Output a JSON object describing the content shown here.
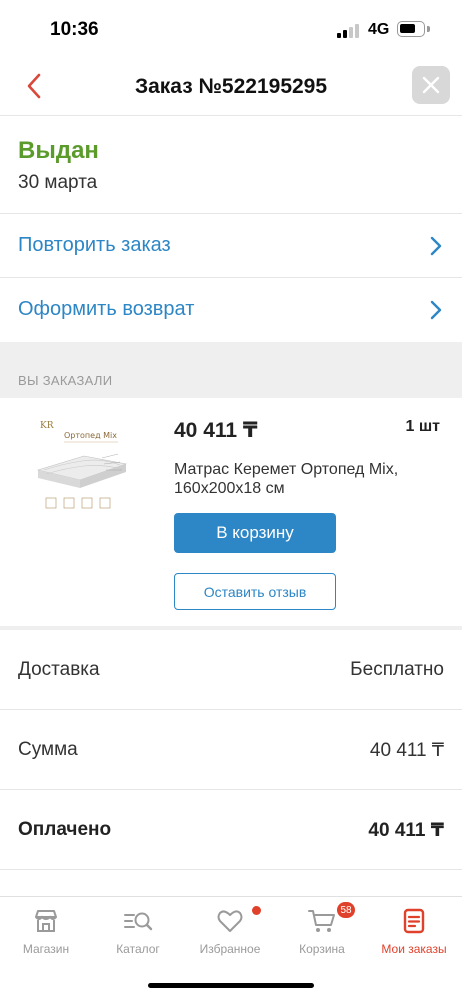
{
  "status_bar": {
    "time": "10:36",
    "network": "4G"
  },
  "header": {
    "title": "Заказ №522195295"
  },
  "order": {
    "status": "Выдан",
    "date": "30 марта"
  },
  "actions": {
    "repeat": "Повторить заказ",
    "return": "Оформить возврат"
  },
  "section": {
    "ordered_label": "ВЫ ЗАКАЗАЛИ"
  },
  "product": {
    "price": "40 411 ₸",
    "quantity": "1 шт",
    "name": "Матрас Керемет Ортопед Mix, 160x200x18 см",
    "image_caption": "Ортопед Mix",
    "cart_button": "В корзину",
    "review_button": "Оставить отзыв"
  },
  "summary": {
    "delivery_label": "Доставка",
    "delivery_value": "Бесплатно",
    "sum_label": "Сумма",
    "sum_value": "40 411 ₸",
    "paid_label": "Оплачено",
    "paid_value": "40 411 ₸"
  },
  "tabbar": {
    "shop": "Магазин",
    "catalog": "Каталог",
    "favorites": "Избранное",
    "cart": "Корзина",
    "cart_badge": "58",
    "orders": "Мои заказы"
  },
  "colors": {
    "accent_blue": "#2d86c5",
    "status_green": "#5b9b2c",
    "active_red": "#e0412b"
  }
}
